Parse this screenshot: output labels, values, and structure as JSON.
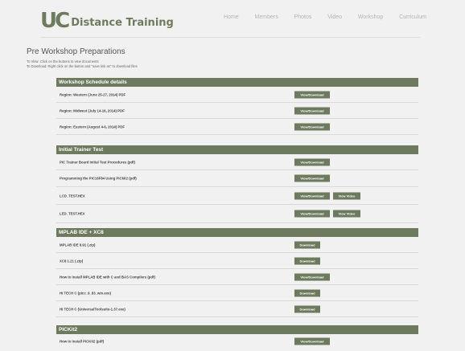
{
  "header": {
    "logo_mark": "UC",
    "logo_text": "Distance Training",
    "nav": [
      "Home",
      "Members",
      "Photos",
      "Video",
      "Workshop",
      "Curriculum"
    ]
  },
  "intro": {
    "title": "Pre Workshop Preparations",
    "line1": "To View: Click on the buttons to view documents",
    "line2": "To Download: Right click on the button and \"save link as\" to download files"
  },
  "sections": [
    {
      "title": "Workshop Schedule details",
      "rows": [
        {
          "label": "Region: Western (June 25-27, 2014) PDF",
          "download": "View/Download"
        },
        {
          "label": "Region: Midwest (July 14-16, 2014) PDF",
          "download": "View/Download"
        },
        {
          "label": "Region: Eastern (August 4-6, 2014) PDF",
          "download": "View/Download"
        }
      ]
    },
    {
      "title": "Initial Trainer Test",
      "rows": [
        {
          "label": "PIC Trainer Board Initial Test Procedures (pdf)",
          "download": "View/Download"
        },
        {
          "label": "Programming the PIC16F84 Using PICkit2 (pdf)",
          "download": "View/Download"
        },
        {
          "label": "LCD_TEST.HEX",
          "download": "View/Download",
          "video": "View Video"
        },
        {
          "label": "LED_TEST.HEX",
          "download": "View/Download",
          "video": "View Video"
        }
      ]
    },
    {
      "title": "MPLAB IDE + XC8",
      "rows": [
        {
          "label": "MPLAB IDE 8.91 (.zip)",
          "download": "Download"
        },
        {
          "label": "XC8 1.21 (.zip)",
          "download": "Download"
        },
        {
          "label": "How to Install MPLAB IDE with C and BAS Compilers (pdf)",
          "download": "View/Download"
        },
        {
          "label": "HI TECH C (picc_9_83_win.exe)",
          "download": "Download"
        },
        {
          "label": "HI TECH C (UniversalToolsuite-1.37.exe)",
          "download": "Download"
        }
      ]
    },
    {
      "title": "PICKit2",
      "rows": [
        {
          "label": "How to Install PICKit2 (pdf)",
          "download": "View/Download"
        }
      ]
    }
  ]
}
